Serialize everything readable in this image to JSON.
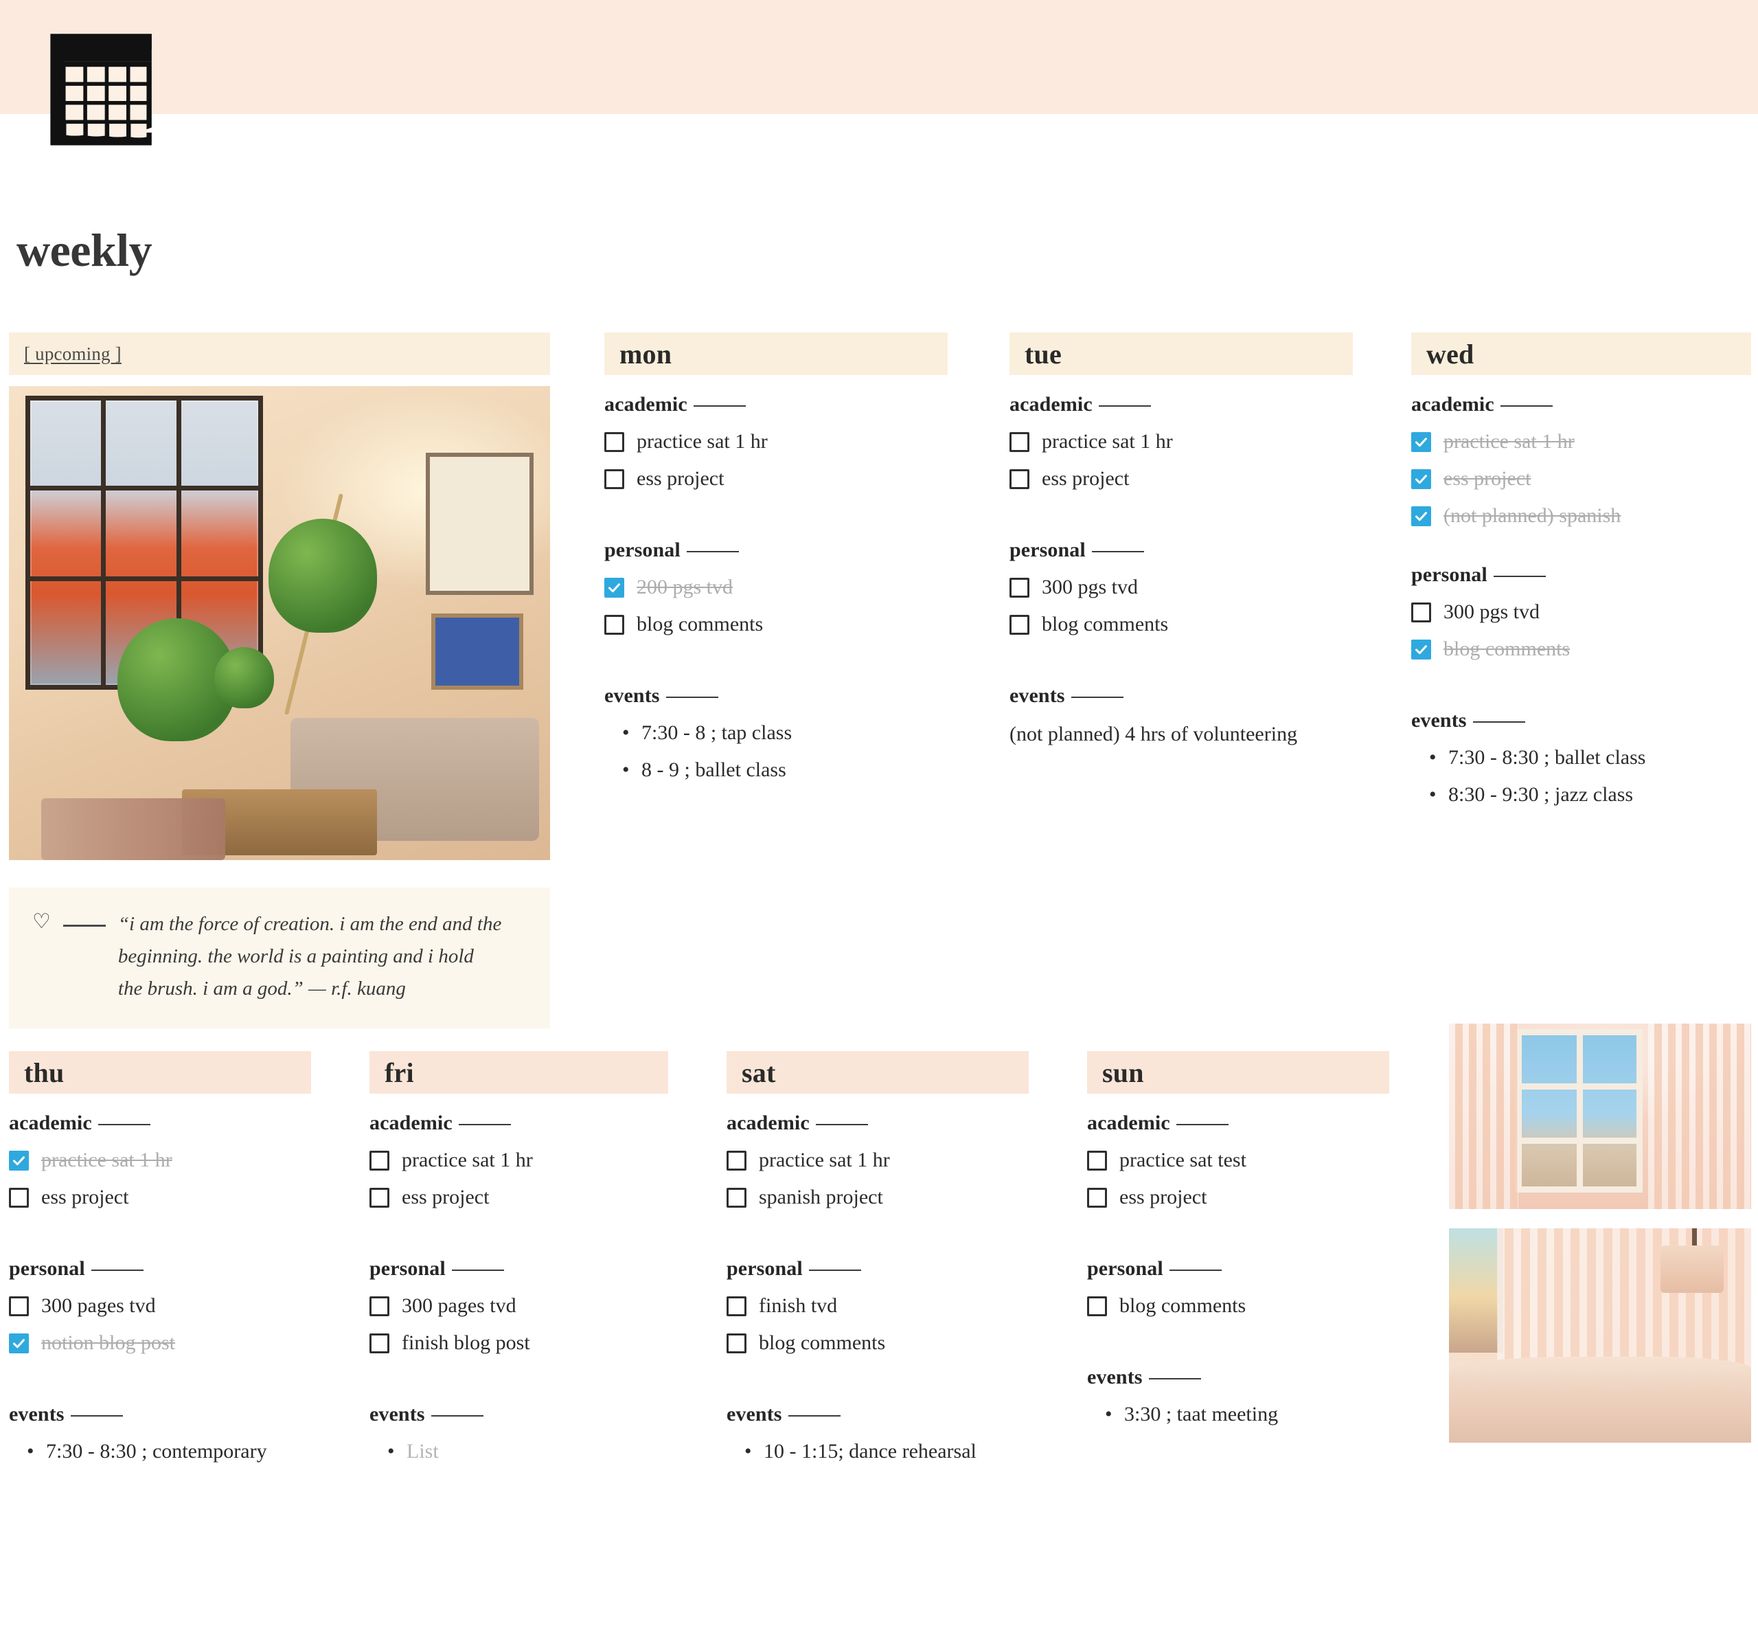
{
  "header": {
    "icon": "calendar-icon",
    "banner_color": "#fceade"
  },
  "page": {
    "title": "weekly"
  },
  "upcoming": {
    "label": "[ upcoming ]",
    "photo_alt": "sunlit-living-room-photo",
    "quote": {
      "icon": "heart-icon",
      "text": "“i am the force of creation. i am the end and the beginning. the world is a painting and i hold the brush. i am a god.” — r.f. kuang"
    }
  },
  "section_labels": {
    "academic": "academic",
    "personal": "personal",
    "events": "events"
  },
  "days": [
    {
      "name": "mon",
      "academic": [
        {
          "text": "practice sat 1 hr",
          "done": false
        },
        {
          "text": "ess project",
          "done": false
        }
      ],
      "personal": [
        {
          "text": "200 pgs tvd",
          "done": true
        },
        {
          "text": "blog comments",
          "done": false
        }
      ],
      "events": [
        {
          "text": "7:30 - 8 ; tap class",
          "bullet": true,
          "placeholder": false
        },
        {
          "text": "8 - 9 ; ballet class",
          "bullet": true,
          "placeholder": false
        }
      ]
    },
    {
      "name": "tue",
      "academic": [
        {
          "text": "practice sat 1 hr",
          "done": false
        },
        {
          "text": "ess project",
          "done": false
        }
      ],
      "personal": [
        {
          "text": "300 pgs tvd",
          "done": false
        },
        {
          "text": "blog comments",
          "done": false
        }
      ],
      "events": [
        {
          "text": "(not planned) 4 hrs of volunteering",
          "bullet": false,
          "placeholder": false
        }
      ]
    },
    {
      "name": "wed",
      "academic": [
        {
          "text": "practice sat 1 hr",
          "done": true
        },
        {
          "text": "ess project",
          "done": true
        },
        {
          "text": "(not planned) spanish",
          "done": true
        }
      ],
      "personal": [
        {
          "text": "300 pgs tvd",
          "done": false
        },
        {
          "text": "blog comments",
          "done": true
        }
      ],
      "events": [
        {
          "text": "7:30 - 8:30 ; ballet class",
          "bullet": true,
          "placeholder": false
        },
        {
          "text": "8:30 - 9:30 ; jazz class",
          "bullet": true,
          "placeholder": false
        }
      ]
    },
    {
      "name": "thu",
      "academic": [
        {
          "text": "practice sat 1 hr",
          "done": true
        },
        {
          "text": "ess project",
          "done": false
        }
      ],
      "personal": [
        {
          "text": "300 pages tvd",
          "done": false
        },
        {
          "text": "notion blog post",
          "done": true
        }
      ],
      "events": [
        {
          "text": "7:30 - 8:30 ; contemporary",
          "bullet": true,
          "placeholder": false
        }
      ]
    },
    {
      "name": "fri",
      "academic": [
        {
          "text": "practice sat 1 hr",
          "done": false
        },
        {
          "text": "ess project",
          "done": false
        }
      ],
      "personal": [
        {
          "text": "300 pages tvd",
          "done": false
        },
        {
          "text": "finish blog post",
          "done": false
        }
      ],
      "events": [
        {
          "text": "List",
          "bullet": true,
          "placeholder": true
        }
      ]
    },
    {
      "name": "sat",
      "academic": [
        {
          "text": "practice sat 1 hr",
          "done": false
        },
        {
          "text": "spanish project",
          "done": false
        }
      ],
      "personal": [
        {
          "text": "finish tvd",
          "done": false
        },
        {
          "text": "blog comments",
          "done": false
        }
      ],
      "events": [
        {
          "text": "10 - 1:15; dance rehearsal",
          "bullet": true,
          "placeholder": false
        }
      ]
    },
    {
      "name": "sun",
      "academic": [
        {
          "text": "practice sat test",
          "done": false
        },
        {
          "text": "ess project",
          "done": false
        }
      ],
      "personal": [
        {
          "text": "blog comments",
          "done": false
        }
      ],
      "events": [
        {
          "text": "3:30 ; taat meeting",
          "bullet": true,
          "placeholder": false
        }
      ]
    }
  ],
  "gallery": [
    {
      "alt": "pink-curtain-window-photo"
    },
    {
      "alt": "sunset-bedroom-photo"
    }
  ],
  "colors": {
    "banner": "#fceade",
    "header_row1": "#faefdc",
    "header_row2": "#fae6d8",
    "checkbox_checked": "#2ea9de",
    "done_text": "#adadad",
    "quote_bg": "#fcf7ec"
  }
}
